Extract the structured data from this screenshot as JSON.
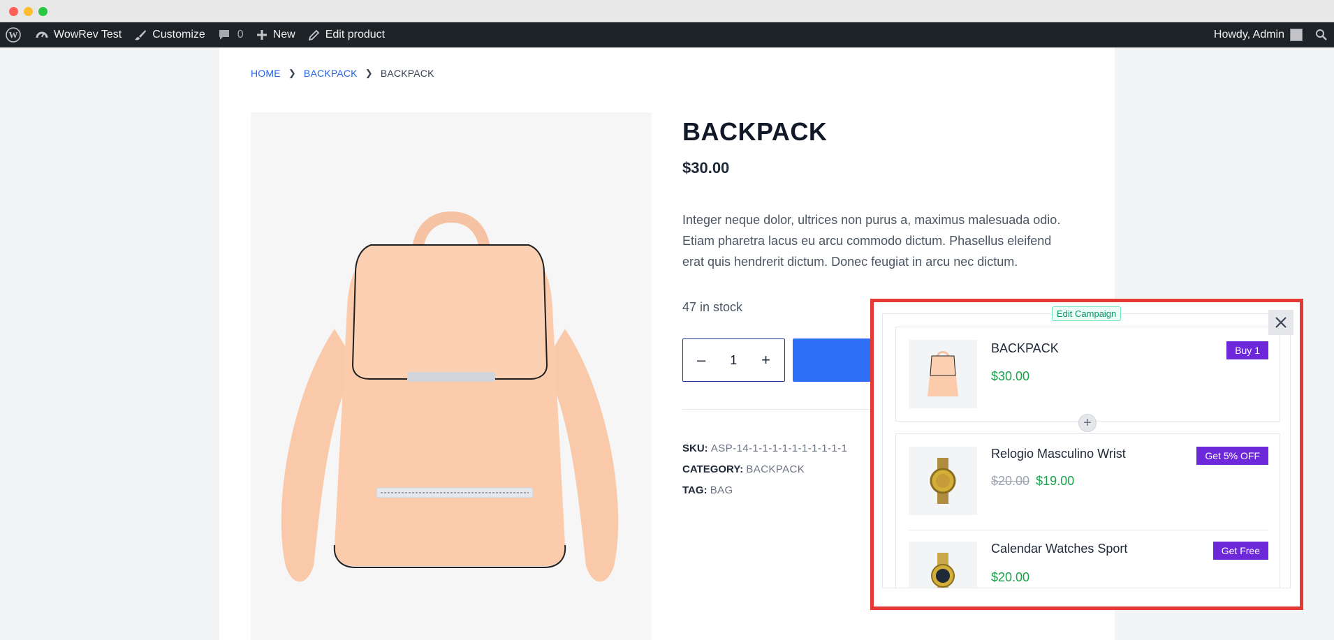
{
  "adminbar": {
    "site_name": "WowRev Test",
    "customize": "Customize",
    "comments_count": "0",
    "new_label": "New",
    "edit_product": "Edit product",
    "howdy": "Howdy, Admin"
  },
  "breadcrumb": {
    "home": "HOME",
    "category": "BACKPACK",
    "current": "BACKPACK"
  },
  "product": {
    "title": "BACKPACK",
    "price": "$30.00",
    "description": "Integer neque dolor, ultrices non purus a, maximus malesuada odio. Etiam pharetra lacus eu arcu commodo dictum. Phasellus eleifend erat quis hendrerit dictum. Donec feugiat in arcu nec dictum.",
    "stock": "47 in stock",
    "quantity": "1",
    "sku_label": "SKU:",
    "sku_value": "ASP-14-1-1-1-1-1-1-1-1-1-1",
    "category_label": "CATEGORY:",
    "category_value": "BACKPACK",
    "tag_label": "TAG:",
    "tag_value": "BAG"
  },
  "popup": {
    "edit_campaign": "Edit Campaign",
    "items": [
      {
        "name": "BACKPACK",
        "price": "$30.00",
        "old_price": "",
        "button": "Buy 1"
      },
      {
        "name": "Relogio Masculino Wrist",
        "price": "$19.00",
        "old_price": "$20.00",
        "button": "Get 5% OFF"
      },
      {
        "name": "Calendar Watches Sport",
        "price": "$20.00",
        "old_price": "",
        "button": "Get Free"
      }
    ]
  },
  "colors": {
    "adminbar_bg": "#1d2327",
    "link_blue": "#2563eb",
    "add_to_cart": "#2f6ff5",
    "offer_purple": "#6d28d9",
    "price_green": "#16a34a",
    "highlight_red": "#e53935"
  },
  "icons": [
    "wordpress-icon",
    "dashboard-icon",
    "brush-icon",
    "comment-icon",
    "plus-icon",
    "pencil-icon",
    "search-icon",
    "close-icon",
    "chevron-right-icon"
  ]
}
